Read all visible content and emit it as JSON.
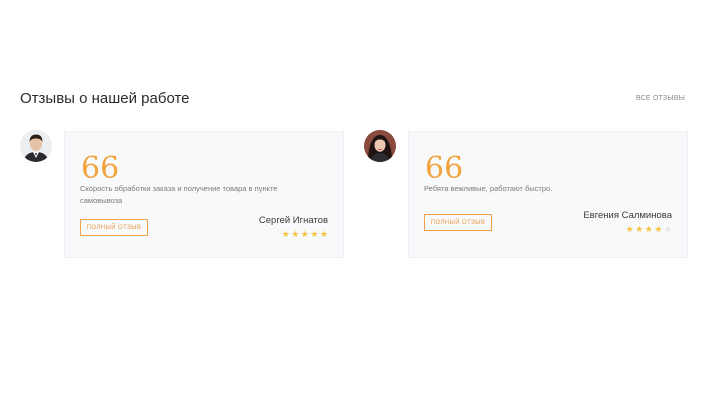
{
  "section": {
    "title": "Отзывы о нашей работе",
    "all_reviews_label": "ВСЕ ОТЗЫВЫ"
  },
  "reviews": [
    {
      "quote_glyph": "66",
      "text": "Скорость обработки заказа и получение товара в пункте самовывоза",
      "button_label": "ПОЛНЫЙ ОТЗЫВ",
      "author": "Сергей Игнатов",
      "rating": 5,
      "rating_max": 5
    },
    {
      "quote_glyph": "66",
      "text": "Ребята вежливые, работают быстро.",
      "button_label": "ПОЛНЫЙ ОТЗЫВ",
      "author": "Евгения Салминова",
      "rating": 4,
      "rating_max": 5
    }
  ],
  "colors": {
    "accent": "#f0a04b",
    "star_on": "#f6c342",
    "star_off": "#e4e4e4",
    "card_bg": "#f8f9fb"
  }
}
